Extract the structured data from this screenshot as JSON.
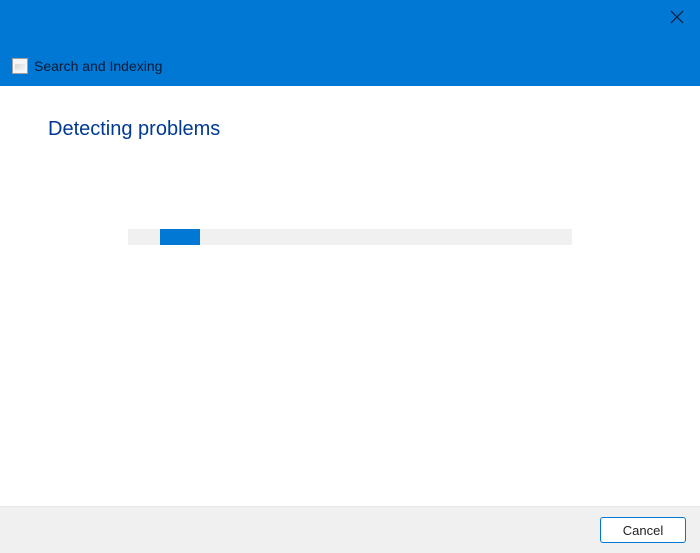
{
  "header": {
    "title": "Search and Indexing",
    "icon_name": "search-indexing-icon"
  },
  "content": {
    "heading": "Detecting problems"
  },
  "footer": {
    "cancel_label": "Cancel"
  },
  "colors": {
    "accent": "#0078d4"
  }
}
